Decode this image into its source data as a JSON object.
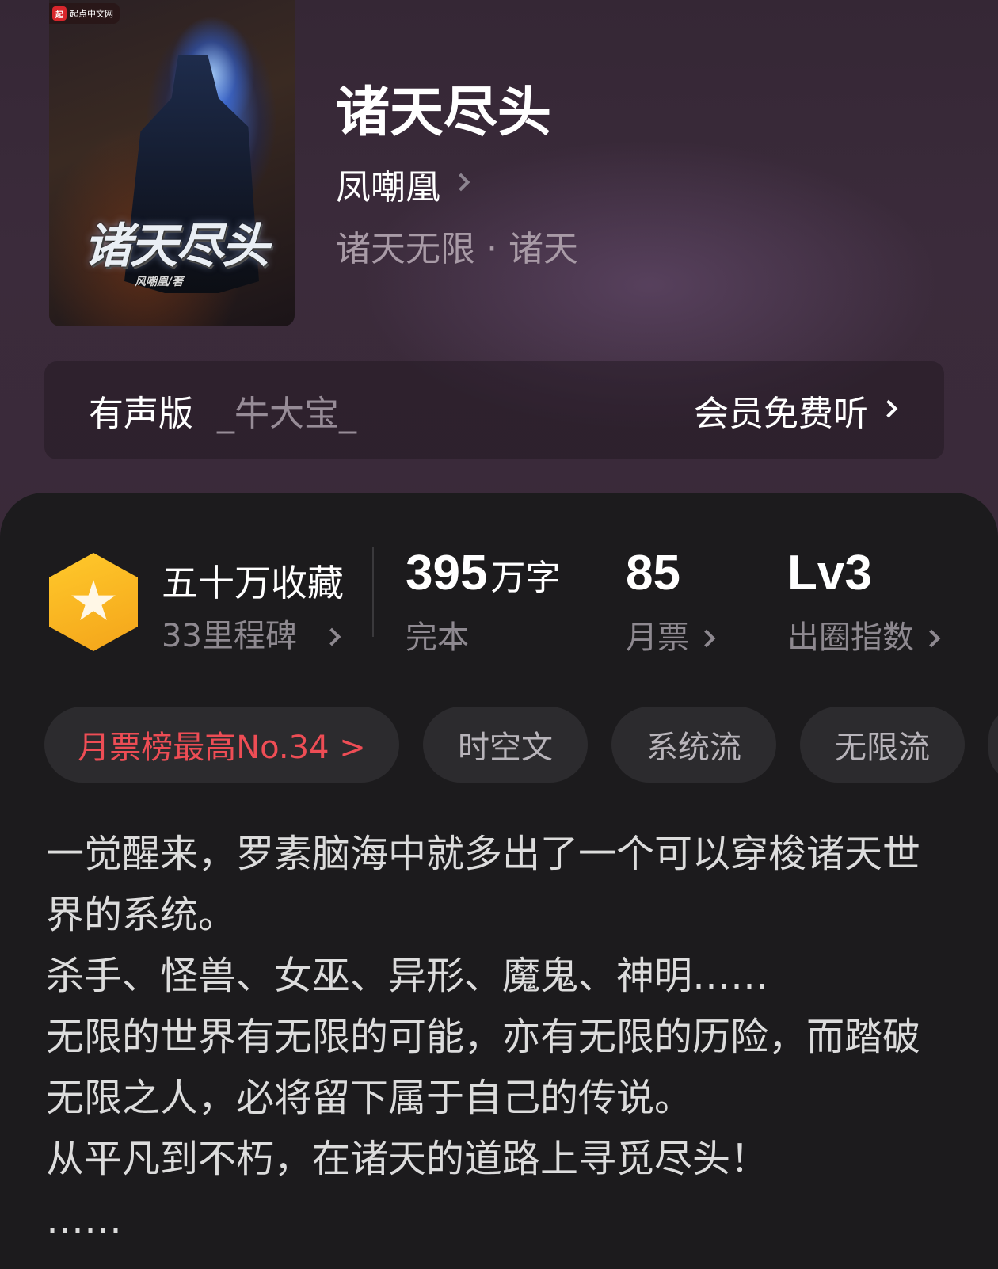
{
  "book": {
    "cover_badge": "起点中文网",
    "cover_badge_logo": "起",
    "cover_title": "诸天尽头",
    "cover_author": "风嘲凰/著",
    "title": "诸天尽头",
    "author": "凤嘲凰",
    "genre": "诸天无限 · 诸天"
  },
  "audio": {
    "label": "有声版",
    "narrator": "_牛大宝_",
    "cta": "会员免费听"
  },
  "stats": {
    "collection_title": "五十万收藏",
    "milestone": "33里程碑",
    "word_count": "395",
    "word_unit": "万字",
    "status": "完本",
    "monthly_votes": "85",
    "monthly_votes_label": "月票",
    "level": "Lv3",
    "level_label": "出圈指数"
  },
  "tags": {
    "rank": "月票榜最高No.34 >",
    "items": [
      "时空文",
      "系统流",
      "无限流"
    ]
  },
  "description": [
    "一觉醒来，罗素脑海中就多出了一个可以穿梭诸天世界的系统。",
    "杀手、怪兽、女巫、异形、魔鬼、神明……",
    "无限的世界有无限的可能，亦有无限的历险，而踏破无限之人，必将留下属于自己的传说。",
    "从平凡到不朽，在诸天的道路上寻觅尽头！",
    "……"
  ],
  "colors": {
    "header_bg": "#3a2a39",
    "card_bg": "#1c1b1d",
    "rank_tag": "#ee4d55",
    "badge_gold": "#f4a41a"
  },
  "icons": {
    "collection_badge": "hexagon-star-icon",
    "chevron": "chevron-right-icon"
  }
}
